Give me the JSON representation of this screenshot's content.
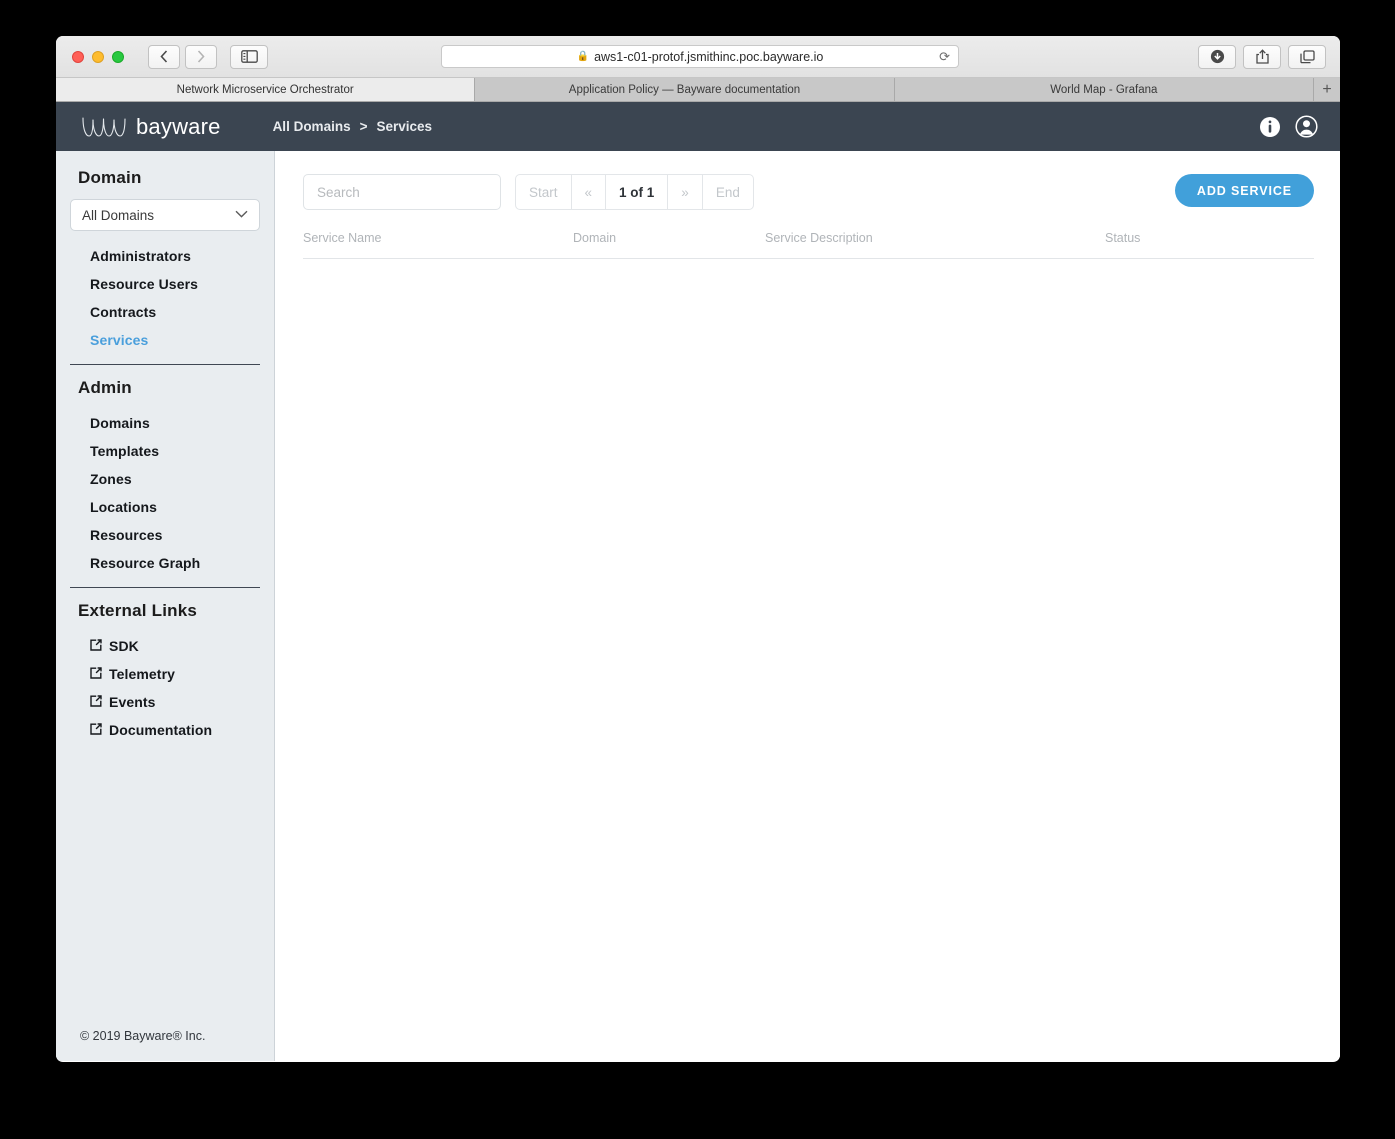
{
  "browser": {
    "url": "aws1-c01-protof.jsmithinc.poc.bayware.io",
    "lock_icon": "lock-icon",
    "reload_icon": "reload-icon",
    "back_icon": "chevron-left-icon",
    "forward_icon": "chevron-right-icon",
    "sidebar_icon": "sidebar-toggle-icon",
    "download_icon": "download-icon",
    "share_icon": "share-icon",
    "tabs_overview_icon": "tabs-overview-icon",
    "new_tab_label": "+",
    "tabs": [
      {
        "label": "Network Microservice Orchestrator",
        "active": true
      },
      {
        "label": "Application Policy — Bayware documentation",
        "active": false
      },
      {
        "label": "World Map - Grafana",
        "active": false
      }
    ]
  },
  "app_header": {
    "logo_text": "bayware",
    "logo_icon": "bayware-wave-logo",
    "breadcrumb": {
      "root": "All Domains",
      "separator": ">",
      "current": "Services"
    },
    "info_icon": "info-icon",
    "account_icon": "user-account-icon"
  },
  "sidebar": {
    "domain": {
      "title": "Domain",
      "select_value": "All Domains",
      "chevron_icon": "chevron-down-icon",
      "items": [
        {
          "label": "Administrators",
          "active": false
        },
        {
          "label": "Resource Users",
          "active": false
        },
        {
          "label": "Contracts",
          "active": false
        },
        {
          "label": "Services",
          "active": true
        }
      ]
    },
    "admin": {
      "title": "Admin",
      "items": [
        {
          "label": "Domains"
        },
        {
          "label": "Templates"
        },
        {
          "label": "Zones"
        },
        {
          "label": "Locations"
        },
        {
          "label": "Resources"
        },
        {
          "label": "Resource Graph"
        }
      ]
    },
    "external_links": {
      "title": "External Links",
      "icon": "external-link-icon",
      "items": [
        {
          "label": "SDK"
        },
        {
          "label": "Telemetry"
        },
        {
          "label": "Events"
        },
        {
          "label": "Documentation"
        }
      ]
    },
    "copyright": "© 2019 Bayware® Inc."
  },
  "main": {
    "search_placeholder": "Search",
    "search_value": "",
    "pagination": {
      "start_label": "Start",
      "prev_label": "«",
      "current_label": "1 of 1",
      "next_label": "»",
      "end_label": "End"
    },
    "add_service_label": "ADD SERVICE",
    "accent_color": "#41a0da",
    "table": {
      "columns": [
        "Service Name",
        "Domain",
        "Service Description",
        "Status"
      ],
      "rows": []
    }
  }
}
